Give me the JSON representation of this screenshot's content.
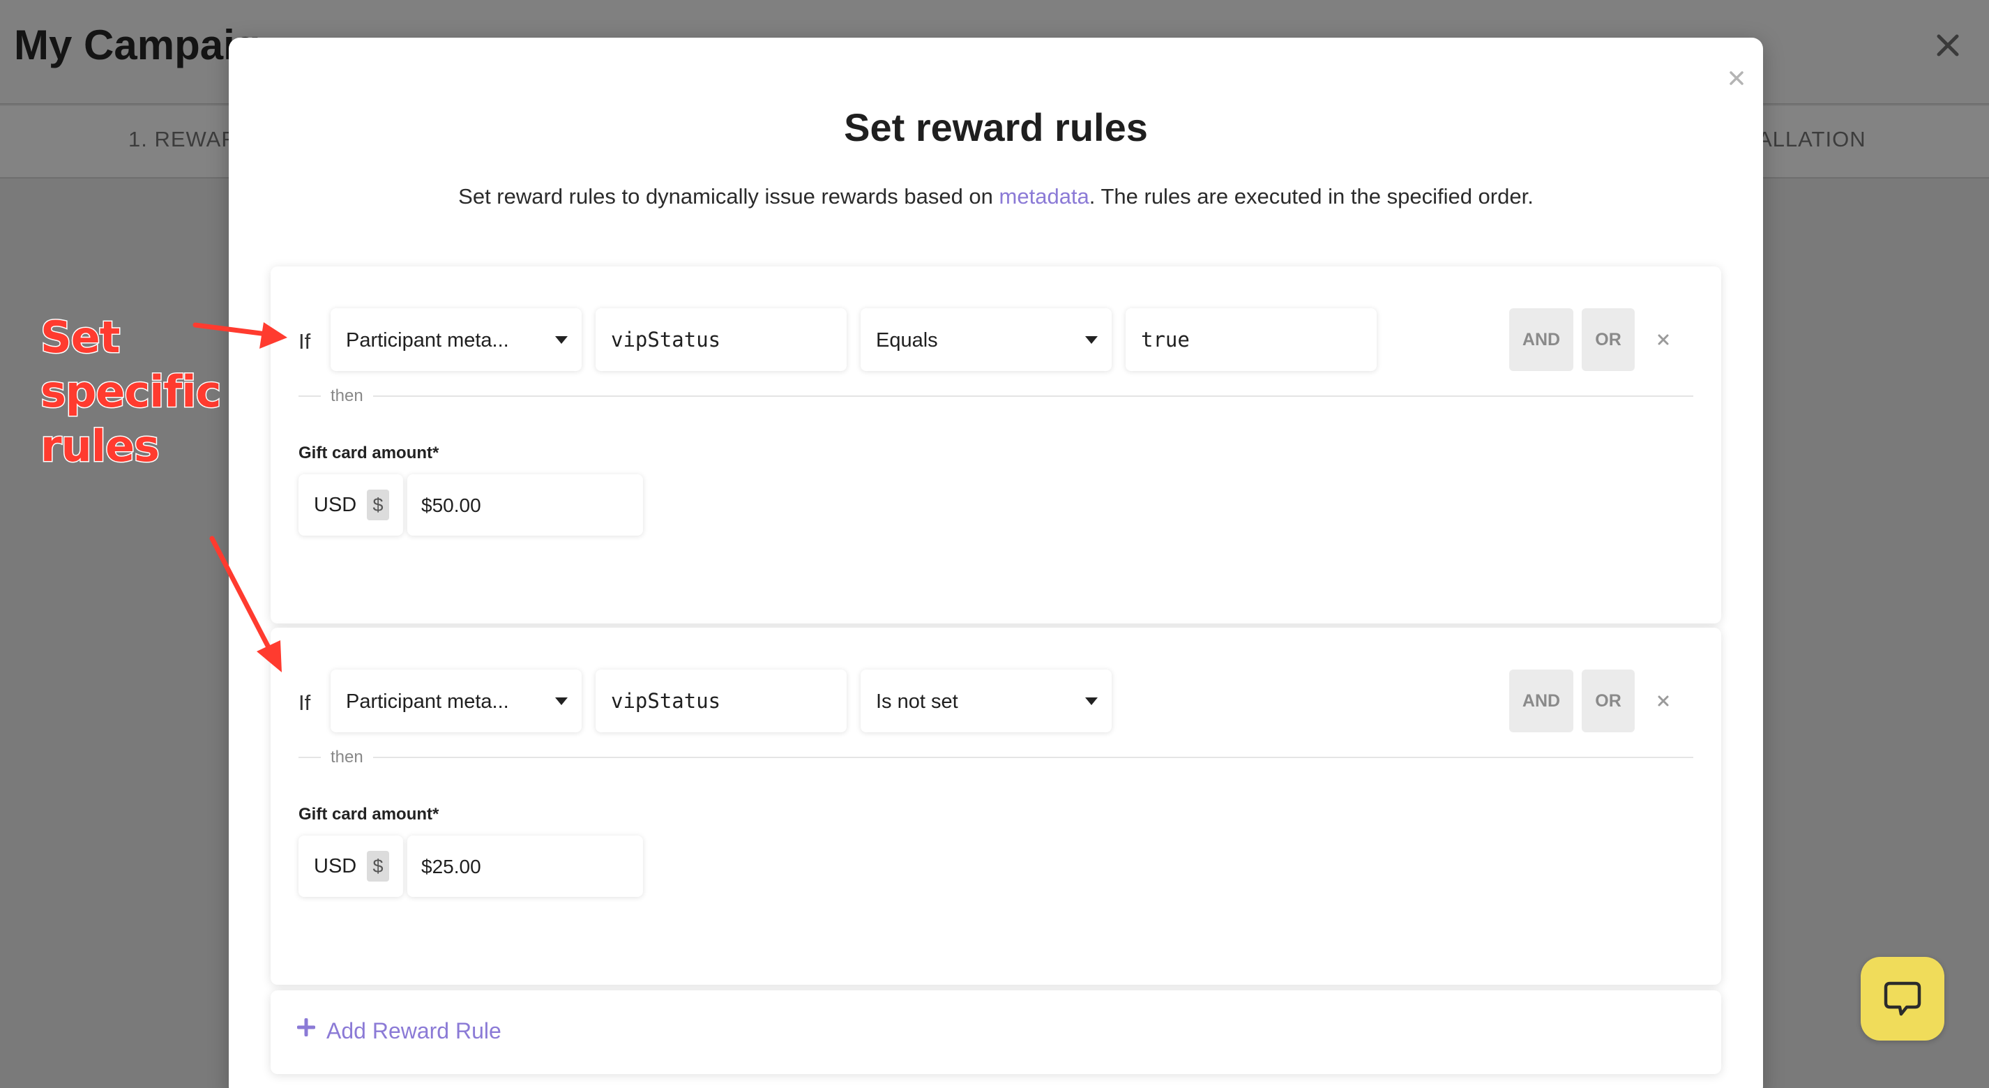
{
  "background": {
    "title": "My Campaig",
    "tab_left": "1. REWAR",
    "tab_right": "ALLATION",
    "close_icon": "close-icon"
  },
  "annotation": {
    "lines": [
      "Set",
      "specific",
      "rules"
    ],
    "color": "#ff3b2f"
  },
  "modal": {
    "title": "Set reward rules",
    "subtitle_before": "Set reward rules to dynamically issue rewards based on ",
    "subtitle_link": "metadata",
    "subtitle_after": ". The rules are executed in the specified order.",
    "link_color": "#8b7ad6",
    "close_icon": "close-icon"
  },
  "rules": [
    {
      "if_label": "If",
      "attribute": "Participant meta...",
      "key": "vipStatus",
      "operator": "Equals",
      "value": "true",
      "and_label": "AND",
      "or_label": "OR",
      "then_label": "then",
      "amount_label": "Gift card amount*",
      "currency": "USD",
      "currency_symbol": "$",
      "amount": "$50.00"
    },
    {
      "if_label": "If",
      "attribute": "Participant meta...",
      "key": "vipStatus",
      "operator": "Is not set",
      "and_label": "AND",
      "or_label": "OR",
      "then_label": "then",
      "amount_label": "Gift card amount*",
      "currency": "USD",
      "currency_symbol": "$",
      "amount": "$25.00"
    }
  ],
  "add_rule": {
    "label": "Add Reward Rule",
    "icon": "plus-icon"
  },
  "help": {
    "icon": "chat-bubble-icon",
    "color": "#f0dc5a"
  }
}
